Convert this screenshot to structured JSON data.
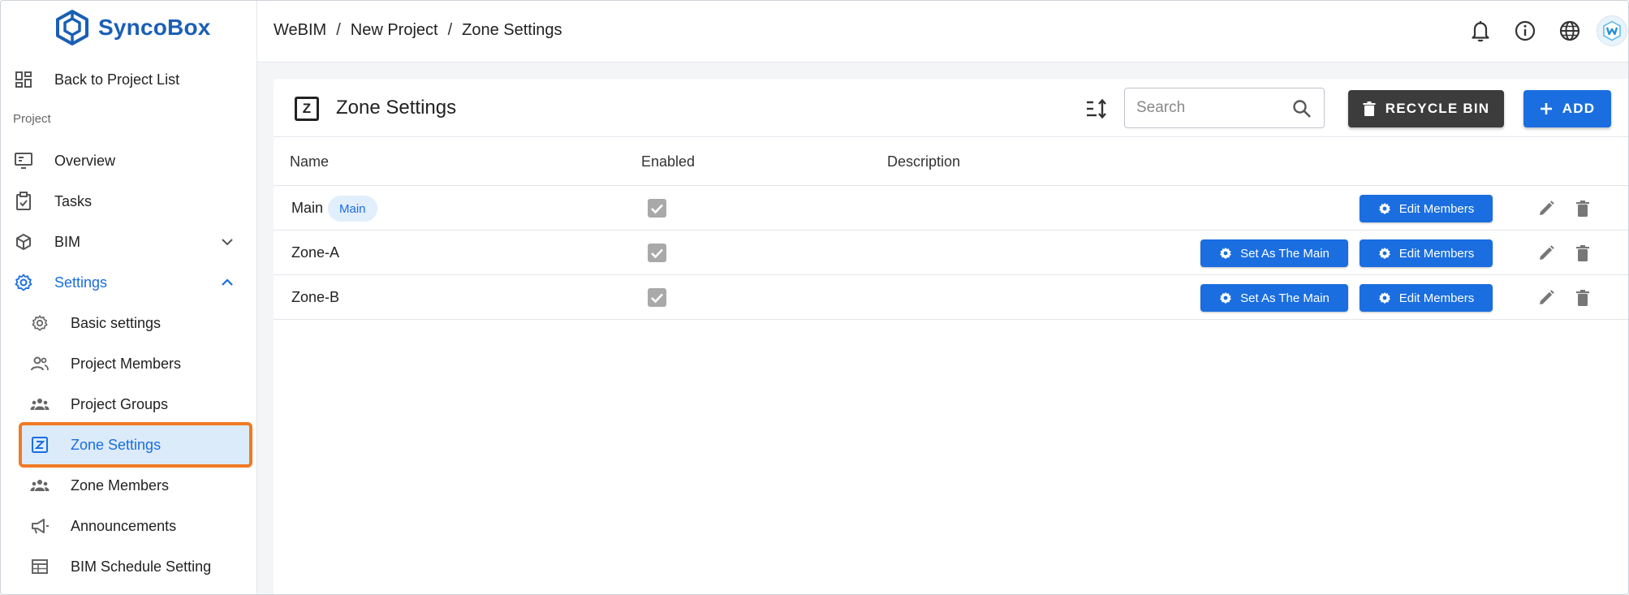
{
  "app": {
    "name": "SyncoBox"
  },
  "sidebar": {
    "back_label": "Back to Project List",
    "section_label": "Project",
    "items": [
      {
        "label": "Overview"
      },
      {
        "label": "Tasks"
      },
      {
        "label": "BIM"
      },
      {
        "label": "Settings"
      }
    ],
    "sub_items": [
      {
        "label": "Basic settings"
      },
      {
        "label": "Project Members"
      },
      {
        "label": "Project Groups"
      },
      {
        "label": "Zone Settings"
      },
      {
        "label": "Zone Members"
      },
      {
        "label": "Announcements"
      },
      {
        "label": "BIM Schedule Setting"
      }
    ]
  },
  "breadcrumb": [
    "WeBIM",
    "New Project",
    "Zone Settings"
  ],
  "breadcrumb_sep": "/",
  "page": {
    "title": "Zone Settings",
    "z_glyph": "Z",
    "search_placeholder": "Search",
    "recycle_label": "RECYCLE BIN",
    "add_label": "ADD"
  },
  "table": {
    "columns": [
      "Name",
      "Enabled",
      "Description"
    ],
    "set_main_label": "Set As The Main",
    "edit_members_label": "Edit Members",
    "rows": [
      {
        "name": "Main",
        "badge": "Main",
        "enabled": true,
        "description": ""
      },
      {
        "name": "Zone-A",
        "badge": "",
        "enabled": true,
        "description": ""
      },
      {
        "name": "Zone-B",
        "badge": "",
        "enabled": true,
        "description": ""
      }
    ]
  },
  "colors": {
    "brand": "#1a5fb4",
    "accent": "#1a6ee0",
    "highlight": "#f07a23",
    "dark_button": "#3c3c3c"
  }
}
